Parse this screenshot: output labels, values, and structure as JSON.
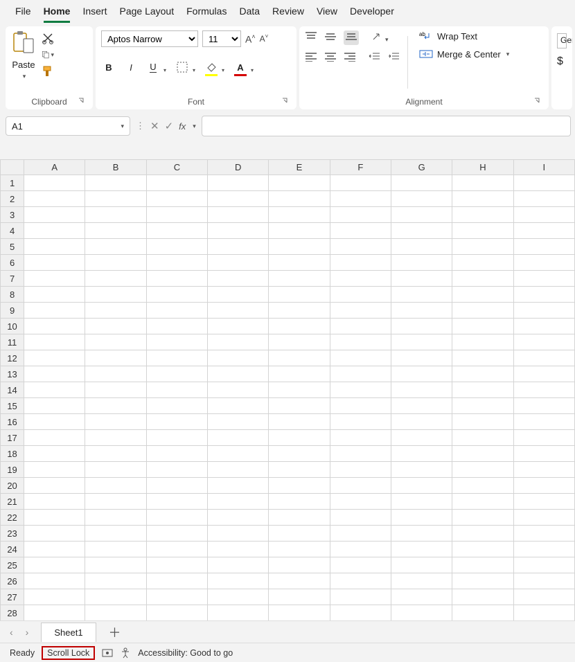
{
  "tabs": {
    "file": "File",
    "home": "Home",
    "insert": "Insert",
    "page_layout": "Page Layout",
    "formulas": "Formulas",
    "data": "Data",
    "review": "Review",
    "view": "View",
    "developer": "Developer"
  },
  "ribbon": {
    "clipboard": {
      "paste": "Paste",
      "label": "Clipboard"
    },
    "font": {
      "name": "Aptos Narrow",
      "size": "11",
      "label": "Font"
    },
    "alignment": {
      "wrap": "Wrap Text",
      "merge": "Merge & Center",
      "label": "Alignment"
    },
    "number": {
      "general": "Ger"
    }
  },
  "fx": {
    "cell": "A1",
    "formula": ""
  },
  "grid": {
    "cols": [
      "A",
      "B",
      "C",
      "D",
      "E",
      "F",
      "G",
      "H",
      "I"
    ],
    "rows": [
      "1",
      "2",
      "3",
      "4",
      "5",
      "6",
      "7",
      "8",
      "9",
      "10",
      "11",
      "12",
      "13",
      "14",
      "15",
      "16",
      "17",
      "18",
      "19",
      "20",
      "21",
      "22",
      "23",
      "24",
      "25",
      "26",
      "27",
      "28"
    ]
  },
  "sheet": {
    "name": "Sheet1"
  },
  "status": {
    "ready": "Ready",
    "scroll_lock": "Scroll Lock",
    "accessibility": "Accessibility: Good to go"
  }
}
